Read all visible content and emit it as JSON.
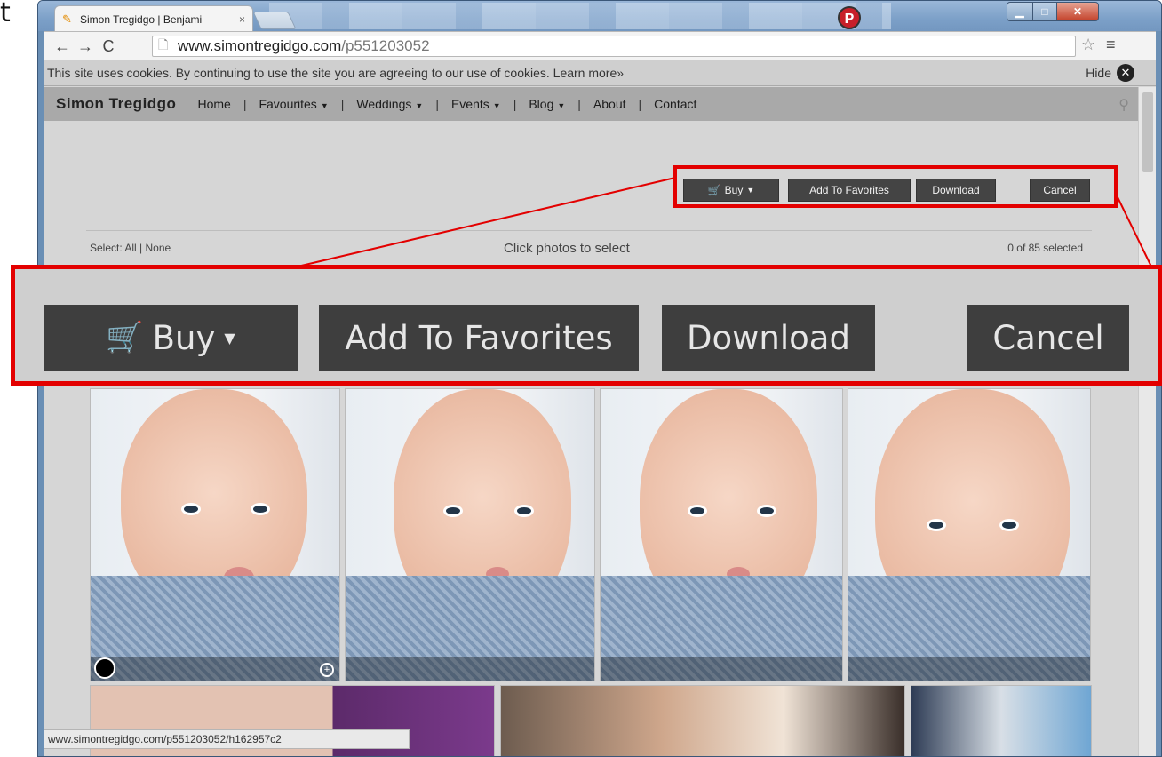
{
  "stray_char": "t",
  "browser": {
    "tab_title": "Simon Tregidgo | Benjami",
    "tab_close": "×",
    "url_host": "www.simontregidgo.com",
    "url_path": "/p551203052",
    "ext_badge": "P"
  },
  "cookie": {
    "text": "This site uses cookies. By continuing to use the site you are agreeing to our use of cookies. Learn more»",
    "hide_label": "Hide"
  },
  "site": {
    "brand": "Simon Tregidgo",
    "nav": [
      "Home",
      "Favourites",
      "Weddings",
      "Events",
      "Blog",
      "About",
      "Contact"
    ]
  },
  "actions": {
    "buy": "Buy",
    "favorites": "Add To Favorites",
    "download": "Download",
    "cancel": "Cancel"
  },
  "selection": {
    "select_label": "Select: All | None",
    "hint": "Click photos to select",
    "count": "0 of 85 selected"
  },
  "status_url": "www.simontregidgo.com/p551203052/h162957c2",
  "colors": {
    "highlight": "#e30000",
    "button_bg": "#444444",
    "nav_bg": "#a9a9a9"
  }
}
